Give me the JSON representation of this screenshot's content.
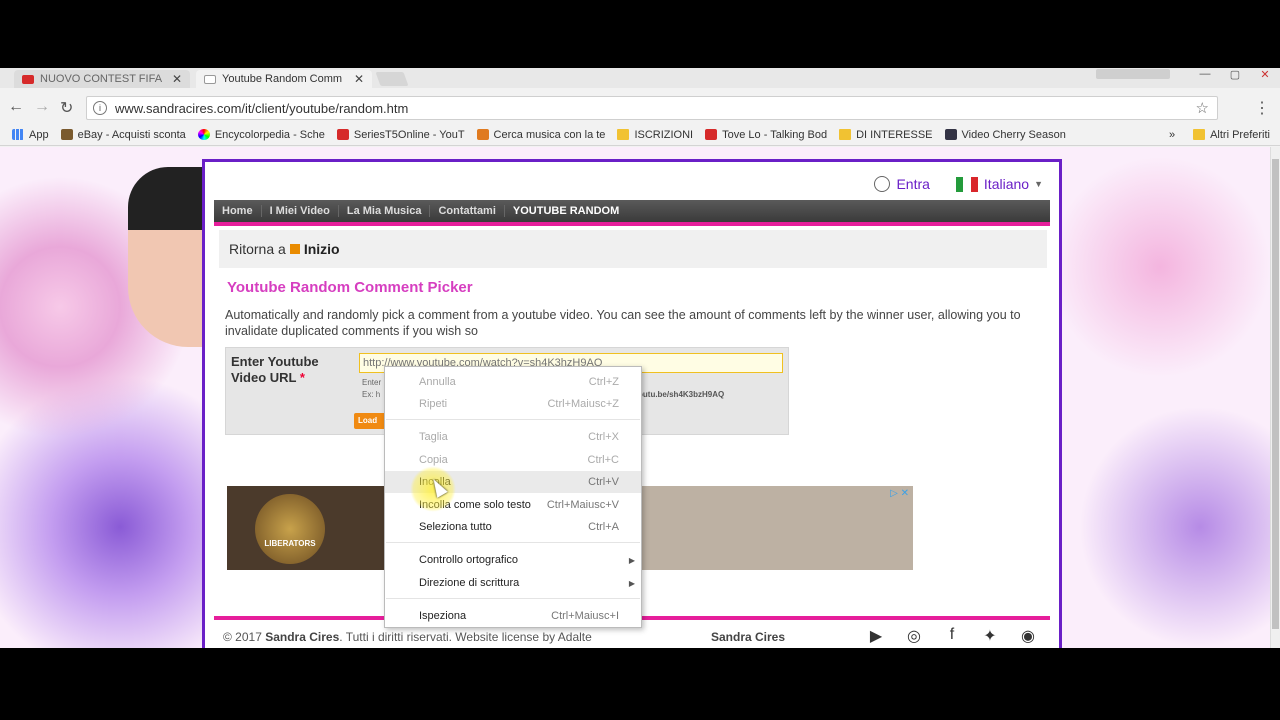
{
  "tabs": [
    {
      "title": "NUOVO CONTEST FIFA P",
      "active": false,
      "icon": "youtube-icon"
    },
    {
      "title": "Youtube Random Comm",
      "active": true,
      "icon": "page-icon"
    }
  ],
  "address": {
    "url": "www.sandracires.com/it/client/youtube/random.htm"
  },
  "bookmarks": [
    {
      "label": "App",
      "icon": "apps-grid-icon"
    },
    {
      "label": "eBay - Acquisti sconta",
      "icon": "bag-icon"
    },
    {
      "label": "Encycolorpedia - Sche",
      "icon": "color-wheel-icon"
    },
    {
      "label": "SeriesT5Online - YouT",
      "icon": "youtube-icon"
    },
    {
      "label": "Cerca musica con la te",
      "icon": "music-icon"
    },
    {
      "label": "ISCRIZIONI",
      "icon": "folder-icon"
    },
    {
      "label": "Tove Lo - Talking Bod",
      "icon": "youtube-icon"
    },
    {
      "label": "DI INTERESSE",
      "icon": "folder-icon"
    },
    {
      "label": "Video Cherry Season",
      "icon": "glasses-icon"
    }
  ],
  "bookmarks_overflow": "»",
  "other_bookmarks": "Altri Preferiti",
  "site": {
    "login": "Entra",
    "language": "Italiano",
    "nav": [
      "Home",
      "I Miei Video",
      "La Mia Musica",
      "Contattami",
      "YOUTUBE RANDOM"
    ],
    "breadcrumb_prefix": "Ritorna a",
    "breadcrumb_link": "Inizio",
    "heading": "Youtube Random Comment Picker",
    "description": "Automatically and randomly pick a comment from a youtube video. You can see the amount of comments left by the winner user, allowing you to invalidate duplicated comments if you wish so",
    "form_label": "Enter Youtube Video URL",
    "required_mark": "*",
    "url_placeholder": "http://www.youtube.com/watch?v=sh4K3hzH9AQ",
    "hint_prefix_1": "Enter",
    "hint_prefix_2": "Ex: h",
    "hint_tail": "outu.be/sh4K3bzH9AQ",
    "load_button": "Load",
    "ad_badge": "LIBERATORS",
    "ad_controls": "▷ ✕",
    "footer_prefix": "© 2017",
    "footer_name": "Sandra Cires",
    "footer_rest": ". Tutti i diritti riservati. Website license by Adalte",
    "footer_brand": "Sandra Cires"
  },
  "context_menu": [
    {
      "label": "Annulla",
      "shortcut": "Ctrl+Z",
      "enabled": false
    },
    {
      "label": "Ripeti",
      "shortcut": "Ctrl+Maiusc+Z",
      "enabled": false
    },
    {
      "label": "Taglia",
      "shortcut": "Ctrl+X",
      "enabled": false
    },
    {
      "label": "Copia",
      "shortcut": "Ctrl+C",
      "enabled": false
    },
    {
      "label": "Incolla",
      "shortcut": "Ctrl+V",
      "enabled": true,
      "hover": true
    },
    {
      "label": "Incolla come solo testo",
      "shortcut": "Ctrl+Maiusc+V",
      "enabled": true
    },
    {
      "label": "Seleziona tutto",
      "shortcut": "Ctrl+A",
      "enabled": true
    },
    {
      "label": "Controllo ortografico",
      "shortcut": "",
      "enabled": true,
      "submenu": true
    },
    {
      "label": "Direzione di scrittura",
      "shortcut": "",
      "enabled": true,
      "submenu": true
    },
    {
      "label": "Ispeziona",
      "shortcut": "Ctrl+Maiusc+I",
      "enabled": true
    }
  ],
  "colors": {
    "accent_pink": "#e61e9b",
    "border_purple": "#6a1fc7",
    "heading_pink": "#d63ec0",
    "load_orange": "#f08a12"
  }
}
